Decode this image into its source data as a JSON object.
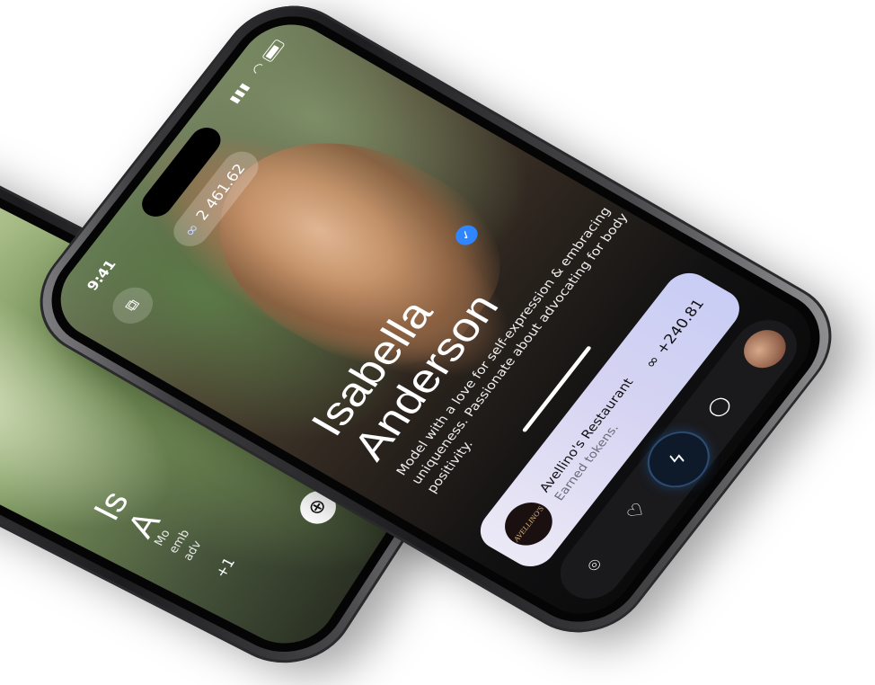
{
  "status_bar": {
    "time": "9:41"
  },
  "token_balance": {
    "value": "2 461.62",
    "icon": "token-icon"
  },
  "profile": {
    "first_name": "Isabella",
    "last_name": "Anderson",
    "verified": true,
    "bio": "Model with a love for self-expression & embracing uniqueness. Passionate about advocating for body positivity."
  },
  "earn_card": {
    "logo_text": "AVELLINO'S",
    "title": "Avellino's Restaurant",
    "subtitle": "Earned tokens.",
    "amount": "+240.81"
  },
  "back_phone": {
    "name_fragment_1": "Is",
    "name_fragment_2": "A",
    "bio_fragment": "Mo\nemb\nadv",
    "amount_fragment": "+1"
  },
  "tab_bar": {
    "items": [
      "scan-icon",
      "heart-icon",
      "flash-icon",
      "chat-icon",
      "avatar"
    ]
  },
  "colors": {
    "verified": "#2f86ff",
    "card_gradient_start": "#ece9f6",
    "card_gradient_end": "#c9cdf5",
    "tab_bar": "#1a1a1d"
  }
}
